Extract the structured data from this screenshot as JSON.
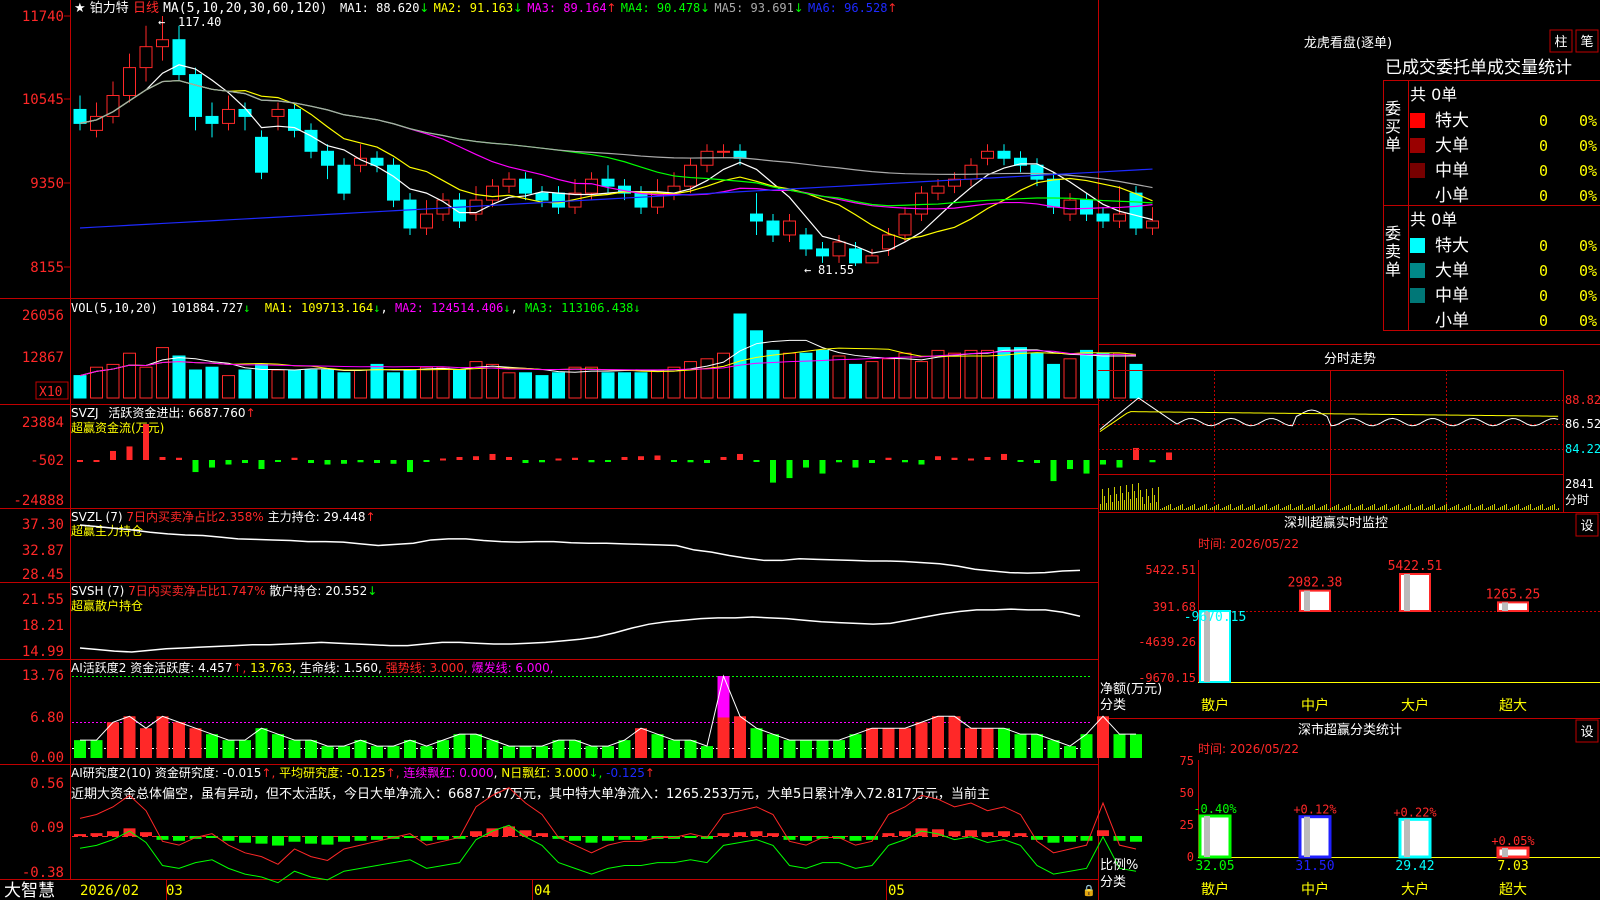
{
  "colors": {
    "up": "#ff2828",
    "down": "#00ffff",
    "grid": "#c00000",
    "yellow": "#ffff00",
    "magenta": "#ff00ff",
    "green": "#00ff00",
    "white": "#ffffff",
    "blue": "#1e2aff",
    "orange": "#ff4a4a",
    "gray": "#aaaaaa"
  },
  "header": {
    "star": "★",
    "name": "铂力特",
    "period": "日线",
    "ma_def": "MA(5,10,20,30,60,120)",
    "ma": [
      {
        "label": "MA1:",
        "value": "88.620",
        "arrow": "↓",
        "color": "#ffffff"
      },
      {
        "label": "MA2:",
        "value": "91.163",
        "arrow": "↓",
        "color": "#ffff00"
      },
      {
        "label": "MA3:",
        "value": "89.164",
        "arrow": "↑",
        "color": "#ff00ff"
      },
      {
        "label": "MA4:",
        "value": "90.478",
        "arrow": "↓",
        "color": "#00ff00"
      },
      {
        "label": "MA5:",
        "value": "93.691",
        "arrow": "↓",
        "color": "#aaaaaa"
      },
      {
        "label": "MA6:",
        "value": "96.528",
        "arrow": "↑",
        "color": "#1e2aff"
      }
    ]
  },
  "price_panel": {
    "axis": [
      "11740",
      "10545",
      "9350",
      "8155"
    ],
    "high_label": "117.40",
    "low_label": "81.55"
  },
  "vol_panel": {
    "title": "VOL(5,10,20)",
    "value": "101884.727",
    "arrow": "↓",
    "ma1": "MA1: 109713.164",
    "ma2": "MA2: 124514.406",
    "ma3": "MA3: 113106.438",
    "axis": [
      "26056",
      "12867"
    ],
    "unit": "X10"
  },
  "svzj_panel": {
    "title": "SVZJ",
    "label": "活跃资金进出:",
    "value": "6687.760",
    "arrow": "↑",
    "sub": "超赢资金流(万元)",
    "axis": [
      "23884",
      "-502",
      "-24888"
    ]
  },
  "svzl_panel": {
    "title": "SVZL (7)",
    "red": "7日内买卖净占比2.358%",
    "label": "主力持仓:",
    "value": "29.448",
    "arrow": "↑",
    "sub": "超赢主力持仓",
    "axis": [
      "37.30",
      "32.87",
      "28.45"
    ]
  },
  "svsh_panel": {
    "title": "SVSH (7)",
    "red": "7日内买卖净占比1.747%",
    "label": "散户持仓:",
    "value": "20.552",
    "arrow": "↓",
    "sub": "超赢散户持仓",
    "axis": [
      "21.55",
      "18.21",
      "14.99"
    ]
  },
  "ai_active": {
    "title": "AI活跃度2",
    "label": "资金活跃度:",
    "value": "4.457",
    "v2": "13.763",
    "life": "生命线: 1.560",
    "strong": "强势线: 3.000",
    "burst": "爆发线: 6.000",
    "axis": [
      "13.76",
      "6.80",
      "0.00"
    ]
  },
  "ai_research": {
    "title": "AI研究度2(10)",
    "label": "资金研究度:",
    "value": "-0.015",
    "avg": "平均研究度: -0.125",
    "cont": "连续飘红: 0.000",
    "n": "N日飘红: 3.000",
    "last": "-0.125",
    "axis": [
      "0.56",
      "0.09",
      "-0.38"
    ],
    "text": "近期大资金总体偏空，虽有异动，但不太活跃，今日大单净流入：6687.767万元，其中特大单净流入：1265.253万元，大单5日累计净入72.817万元，当前主"
  },
  "xaxis": {
    "brand": "大智慧",
    "labels": [
      "2026/02",
      "03",
      "04",
      "05"
    ]
  },
  "right": {
    "lhb": {
      "title": "龙虎看盘(逐单)",
      "btn1": "柱",
      "btn2": "笔",
      "header": "已成交委托单成交量统计",
      "buy": {
        "side": "委买单",
        "count": "共 0单",
        "rows": [
          {
            "name": "特大",
            "v": "0",
            "p": "0%",
            "color": "#ff0000"
          },
          {
            "name": "大单",
            "v": "0",
            "p": "0%",
            "color": "#990000"
          },
          {
            "name": "中单",
            "v": "0",
            "p": "0%",
            "color": "#770000"
          },
          {
            "name": "小单",
            "v": "0",
            "p": "0%",
            "color": "#000000"
          }
        ]
      },
      "sell": {
        "side": "委卖单",
        "count": "共 0单",
        "rows": [
          {
            "name": "特大",
            "v": "0",
            "p": "0%",
            "color": "#00ffff"
          },
          {
            "name": "大单",
            "v": "0",
            "p": "0%",
            "color": "#008888"
          },
          {
            "name": "中单",
            "v": "0",
            "p": "0%",
            "color": "#007777"
          },
          {
            "name": "小单",
            "v": "0",
            "p": "0%",
            "color": "#000000"
          }
        ]
      }
    },
    "fenshi": {
      "title": "分时走势",
      "axis": [
        "88.82",
        "86.52",
        "84.22",
        "2841",
        "分时"
      ]
    },
    "sz_monitor": {
      "title": "深圳超赢实时监控",
      "btn": "设",
      "time": "时间: 2026/05/22",
      "axis": [
        "5422.51",
        "391.68",
        "-4639.26",
        "-9670.15"
      ],
      "ylabel": "净额(万元)",
      "xlabel": "分类",
      "bars": [
        {
          "name": "散户",
          "value": -9670.15,
          "label": "-9670.15",
          "color": "#00ffff"
        },
        {
          "name": "中户",
          "value": 2982.38,
          "label": "2982.38",
          "color": "#ff2828"
        },
        {
          "name": "大户",
          "value": 5422.51,
          "label": "5422.51",
          "color": "#ff2828"
        },
        {
          "name": "超大",
          "value": 1265.25,
          "label": "1265.25",
          "color": "#ff2828"
        }
      ]
    },
    "sz_class": {
      "title": "深市超赢分类统计",
      "btn": "设",
      "time": "时间: 2026/05/22",
      "axis": [
        "75",
        "50",
        "25",
        "0"
      ],
      "ylabel": "比例%",
      "xlabel": "分类",
      "bars": [
        {
          "name": "散户",
          "value": 32.05,
          "label": "32.05",
          "delta": "-0.40%",
          "color": "#00ff00"
        },
        {
          "name": "中户",
          "value": 31.5,
          "label": "31.50",
          "delta": "+0.12%",
          "color": "#2020ff"
        },
        {
          "name": "大户",
          "value": 29.42,
          "label": "29.42",
          "delta": "+0.22%",
          "color": "#00ffff"
        },
        {
          "name": "超大",
          "value": 7.03,
          "label": "7.03",
          "delta": "+0.05%",
          "color": "#ff2828"
        }
      ]
    }
  },
  "chart_data": [
    {
      "type": "candlestick",
      "title": "铂力特 日线",
      "ylim": [
        81.55,
        117.4
      ],
      "candles": [
        [
          104,
          102,
          106,
          101
        ],
        [
          101,
          103,
          105,
          100
        ],
        [
          103,
          106,
          108,
          102
        ],
        [
          106,
          110,
          112,
          105
        ],
        [
          110,
          113,
          116,
          108
        ],
        [
          113,
          114,
          117.4,
          111
        ],
        [
          114,
          109,
          116,
          108
        ],
        [
          109,
          103,
          110,
          101
        ],
        [
          103,
          102,
          105,
          100
        ],
        [
          102,
          104,
          106,
          101
        ],
        [
          104,
          103,
          105,
          101
        ],
        [
          100,
          95,
          101,
          94
        ],
        [
          103,
          104,
          105,
          101
        ],
        [
          104,
          101,
          105,
          100
        ],
        [
          101,
          98,
          102,
          97
        ],
        [
          98,
          96,
          99,
          94
        ],
        [
          96,
          92,
          97,
          91
        ],
        [
          96,
          97,
          99,
          95
        ],
        [
          97,
          96,
          98,
          95
        ],
        [
          96,
          91,
          97,
          90
        ],
        [
          91,
          87,
          92,
          86
        ],
        [
          87,
          89,
          91,
          86
        ],
        [
          89,
          91,
          92,
          88
        ],
        [
          91,
          88,
          92,
          87
        ],
        [
          89,
          91,
          93,
          88
        ],
        [
          91,
          93,
          94,
          90
        ],
        [
          93,
          94,
          95,
          92
        ],
        [
          94,
          92,
          95,
          91
        ],
        [
          92,
          91,
          93,
          90
        ],
        [
          92,
          90,
          93,
          89
        ],
        [
          90,
          92,
          94,
          89
        ],
        [
          92,
          94,
          95,
          91
        ],
        [
          94,
          93,
          96,
          92
        ],
        [
          93,
          92,
          94,
          91
        ],
        [
          92,
          90,
          93,
          89
        ],
        [
          90,
          92,
          94,
          89
        ],
        [
          92,
          93,
          95,
          91
        ],
        [
          93,
          96,
          97,
          92
        ],
        [
          96,
          98,
          99,
          95
        ],
        [
          98,
          98,
          99,
          97
        ],
        [
          98,
          97,
          99,
          96
        ],
        [
          89,
          88,
          92,
          86
        ],
        [
          88,
          86,
          89,
          85
        ],
        [
          86,
          88,
          89,
          85
        ],
        [
          86,
          84,
          87,
          83
        ],
        [
          84,
          83,
          85,
          82
        ],
        [
          83,
          85,
          86,
          82
        ],
        [
          84,
          82,
          85,
          81.55
        ],
        [
          82,
          83,
          84,
          82
        ],
        [
          84,
          86,
          87,
          83
        ],
        [
          86,
          89,
          90,
          85
        ],
        [
          89,
          92,
          93,
          88
        ],
        [
          92,
          93,
          94,
          91
        ],
        [
          93,
          94,
          95,
          92
        ],
        [
          94,
          96,
          97,
          93
        ],
        [
          97,
          98,
          99,
          96
        ],
        [
          98,
          97,
          99,
          96
        ],
        [
          97,
          96,
          98,
          95
        ],
        [
          96,
          94,
          97,
          93
        ],
        [
          94,
          90,
          95,
          89
        ],
        [
          89,
          91,
          92,
          88
        ],
        [
          91,
          89,
          92,
          88
        ],
        [
          89,
          88,
          90,
          87
        ],
        [
          88,
          89,
          93,
          87
        ],
        [
          92,
          87,
          93,
          86
        ],
        [
          87,
          88,
          90,
          86
        ]
      ]
    },
    {
      "type": "bar",
      "title": "VOL",
      "values": [
        8,
        11,
        12,
        16,
        11,
        18,
        15,
        10,
        11,
        8,
        10,
        12,
        10,
        10,
        10,
        10,
        9,
        10,
        12,
        9,
        10,
        11,
        11,
        10,
        13,
        12,
        9,
        9,
        8,
        9,
        11,
        11,
        9,
        9,
        9,
        10,
        11,
        13,
        14,
        16,
        30,
        24,
        17,
        16,
        16,
        17,
        15,
        12,
        13,
        14,
        16,
        13,
        17,
        16,
        17,
        17,
        18,
        18,
        16,
        12,
        14,
        17,
        16,
        16,
        12
      ]
    },
    {
      "type": "bar",
      "title": "SVZJ",
      "values": [
        0,
        0,
        6000,
        9000,
        23884,
        2000,
        1500,
        -8000,
        -5000,
        -3000,
        -2000,
        -6000,
        -1000,
        1500,
        -2000,
        -3000,
        -2500,
        -1500,
        -2000,
        -2500,
        -8000,
        -1000,
        1000,
        2000,
        2500,
        4000,
        2000,
        -2000,
        -1500,
        1000,
        1500,
        -1500,
        -1000,
        2000,
        2500,
        3000,
        -1000,
        -1500,
        -2000,
        2000,
        4000,
        -1000,
        -15000,
        -12000,
        -5000,
        -9000,
        -1500,
        -5000,
        -2000,
        1500,
        -1500,
        -3000,
        2500,
        1500,
        1000,
        2000,
        4000,
        -1000,
        -2000,
        -14000,
        -6000,
        -9000,
        -3000,
        -5000,
        8000,
        -1500,
        5000
      ]
    },
    {
      "type": "line",
      "title": "SVZL",
      "values": [
        37.3,
        37.0,
        36.7,
        36.4,
        36.0,
        35.7,
        35.5,
        35.4,
        35.1,
        34.8,
        34.7,
        34.6,
        34.5,
        34.3,
        34.3,
        34.2,
        33.9,
        33.6,
        33.8,
        34.0,
        34.6,
        34.8,
        34.8,
        34.5,
        34.3,
        34.2,
        34.3,
        34.3,
        34.1,
        34.0,
        34.0,
        33.9,
        33.8,
        33.7,
        33.6,
        32.8,
        32.4,
        31.8,
        31.3,
        30.9,
        30.9,
        31.2,
        31.1,
        31.0,
        30.9,
        30.8,
        30.8,
        30.7,
        30.5,
        30.3,
        29.9,
        29.3,
        29.0,
        28.7,
        28.6,
        28.7,
        29.0,
        29.1
      ]
    },
    {
      "type": "line",
      "title": "SVSH",
      "values": [
        15.5,
        15.3,
        15.1,
        14.99,
        15.2,
        15.4,
        15.5,
        15.6,
        15.7,
        15.8,
        15.9,
        15.9,
        16.0,
        16.1,
        16.2,
        16.1,
        16.0,
        15.9,
        15.8,
        15.8,
        16.0,
        16.2,
        16.2,
        16.1,
        16.0,
        16.0,
        16.1,
        16.2,
        16.4,
        16.6,
        16.9,
        17.4,
        18.0,
        18.5,
        18.8,
        19.0,
        19.2,
        19.3,
        19.3,
        19.4,
        19.3,
        19.2,
        19.0,
        18.8,
        18.7,
        18.6,
        18.5,
        18.6,
        19.0,
        19.4,
        19.8,
        20.1,
        20.3,
        20.3,
        20.4,
        20.3,
        20.3,
        20.0,
        19.5
      ]
    },
    {
      "type": "bar",
      "title": "AI活跃度2",
      "values": [
        3,
        3,
        6,
        7,
        5,
        7,
        6,
        5,
        4,
        3,
        3,
        5,
        4,
        3,
        3,
        2,
        2,
        3,
        2,
        2,
        3,
        2,
        3,
        4,
        4,
        3,
        2,
        2,
        2,
        3,
        3,
        2,
        2,
        3,
        5,
        4,
        3,
        3,
        2,
        13.76,
        7,
        5,
        4,
        3,
        3,
        3,
        3,
        4,
        5,
        5,
        5,
        6,
        7,
        7,
        5,
        5,
        5,
        4,
        4,
        3,
        2,
        4,
        7,
        4,
        4
      ]
    },
    {
      "type": "bar",
      "title": "AI研究度2(10)",
      "values": [
        0.02,
        0.03,
        0.05,
        0.08,
        0.04,
        -0.04,
        -0.05,
        -0.03,
        -0.02,
        -0.05,
        -0.07,
        -0.08,
        -0.1,
        -0.06,
        -0.08,
        -0.09,
        -0.06,
        -0.05,
        -0.04,
        -0.03,
        -0.02,
        -0.05,
        -0.04,
        -0.03,
        0.05,
        0.08,
        0.1,
        0.06,
        0.03,
        -0.03,
        -0.05,
        -0.07,
        -0.05,
        -0.04,
        -0.04,
        -0.03,
        -0.03,
        -0.02,
        -0.03,
        0.03,
        0.04,
        0.05,
        0.03,
        -0.04,
        -0.05,
        -0.03,
        -0.03,
        -0.05,
        -0.04,
        0.03,
        0.05,
        0.08,
        0.07,
        0.05,
        0.06,
        0.04,
        0.05,
        0.03,
        -0.04,
        -0.07,
        -0.06,
        -0.05,
        0.06,
        -0.05,
        -0.06
      ]
    },
    {
      "type": "bar",
      "title": "深圳超赢实时监控",
      "categories": [
        "散户",
        "中户",
        "大户",
        "超大"
      ],
      "values": [
        -9670.15,
        2982.38,
        5422.51,
        1265.25
      ],
      "ylabel": "净额(万元)",
      "xlabel": "分类"
    },
    {
      "type": "bar",
      "title": "深市超赢分类统计",
      "categories": [
        "散户",
        "中户",
        "大户",
        "超大"
      ],
      "values": [
        32.05,
        31.5,
        29.42,
        7.03
      ],
      "ylabel": "比例%",
      "xlabel": "分类",
      "ylim": [
        0,
        75
      ]
    }
  ]
}
